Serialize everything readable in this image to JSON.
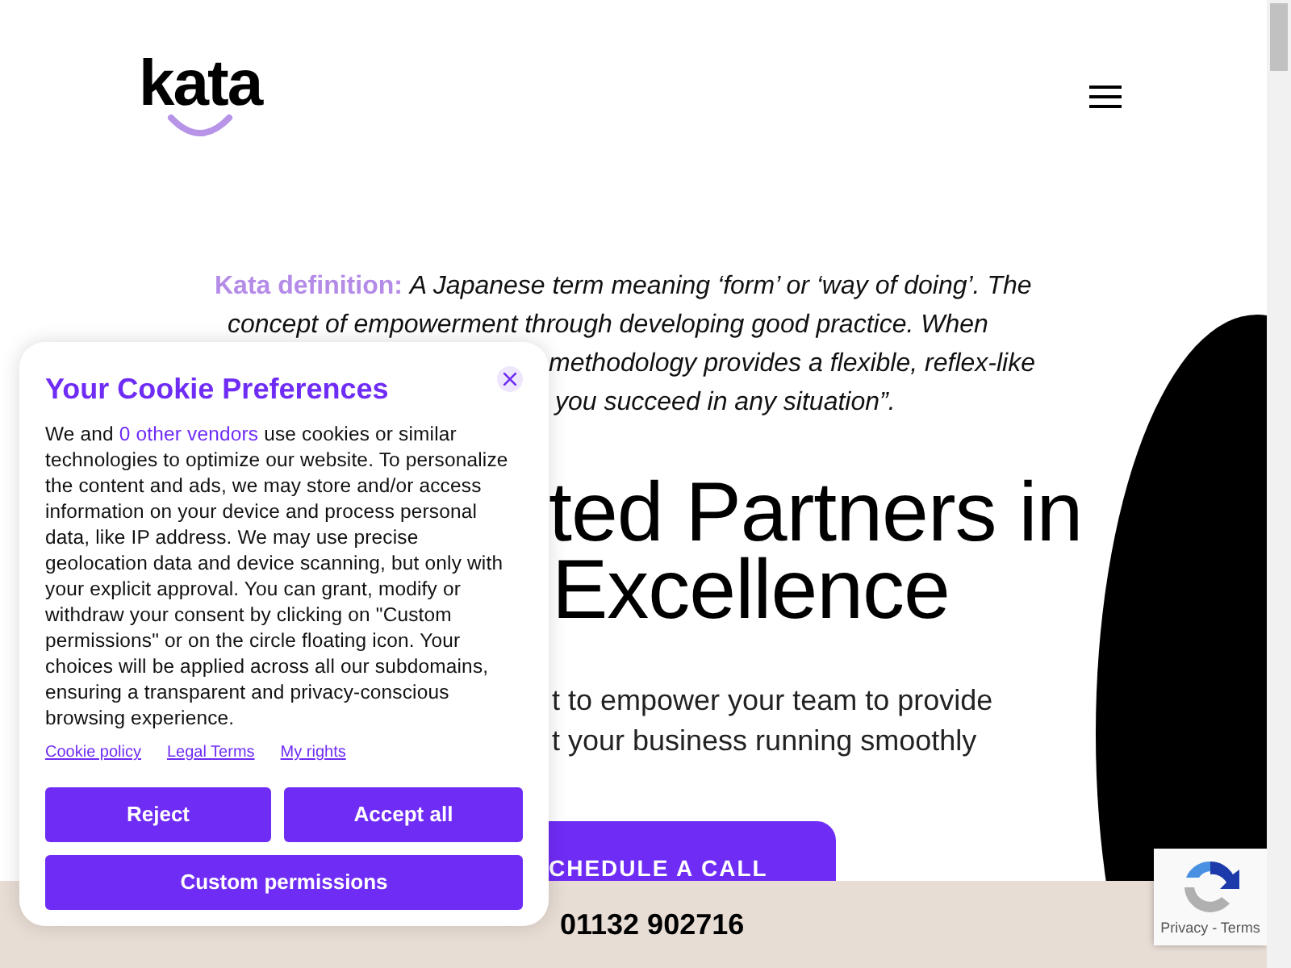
{
  "header": {
    "logo": "kata"
  },
  "definition": {
    "lines": [
      "**Kata definition:** *A Japanese term meaning ‘form’ or ‘way of doing’. The*",
      "*concept of empowerment through developing good practice. When*",
      "*methodology provides a flexible, reflex-like*",
      "*you succeed in any situation”.*"
    ]
  },
  "hero": {
    "heading_lines": [
      "ted Partners in",
      "Excellence"
    ],
    "subtitle_lines": [
      "t to empower your team to provide",
      "t your business running smoothly"
    ],
    "cta": "CHEDULE A CALL"
  },
  "footer_bar": {
    "phone": "01132 902716"
  },
  "recaptcha": {
    "links": "Privacy - Terms"
  },
  "cookie_dialog": {
    "title": "Your Cookie Preferences",
    "body_before": "We and ",
    "body_link": "0 other vendors",
    "body_after": " use cookies or similar technologies to optimize our website. To personalize the content and ads, we may store and/or access information on your device and process personal data, like IP address. We may use precise geolocation data and device scanning, but only with your explicit approval. You can grant, modify or withdraw your consent by clicking on \"Custom permissions\" or on the circle floating icon. Your choices will be applied across all our subdomains, ensuring a transparent and privacy-conscious browsing experience.",
    "links": [
      "Cookie policy",
      "Legal Terms",
      "My rights"
    ],
    "buttons": [
      "Reject",
      "Accept all",
      "Custom permissions"
    ]
  }
}
